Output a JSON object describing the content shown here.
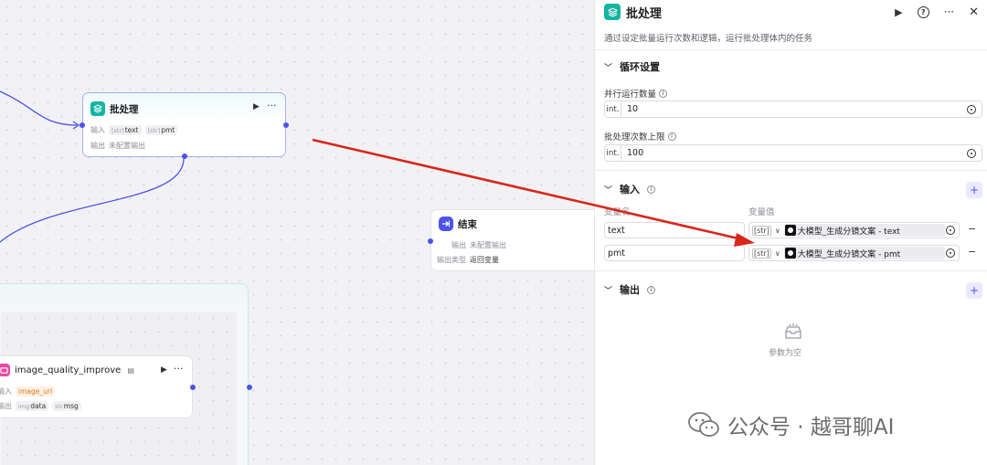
{
  "canvas": {
    "batch_node": {
      "title": "批处理",
      "input_label": "输入",
      "inputs": [
        {
          "type": "[str]",
          "name": "text"
        },
        {
          "type": "[str]",
          "name": "pmt"
        }
      ],
      "output_label": "输出",
      "output_value": "未配置输出"
    },
    "end_node": {
      "title": "结束",
      "output_label": "输出",
      "output_value": "未配置输出",
      "output_type_label": "输出类型",
      "output_type_value": "返回变量"
    },
    "plugin_node": {
      "title": "image_quality_improve",
      "input_label": "输入",
      "input_chip": "image_url",
      "output_label": "输出",
      "outputs": [
        {
          "type": "img",
          "name": "data"
        },
        {
          "type": "str",
          "name": "msg"
        }
      ]
    }
  },
  "panel": {
    "title": "批处理",
    "description": "通过设定批量运行次数和逻辑，运行批处理体内的任务",
    "loop_section": {
      "title": "循环设置",
      "parallel_label": "并行运行数量",
      "parallel_type": "int.",
      "parallel_value": "10",
      "max_label": "批处理次数上限",
      "max_type": "int.",
      "max_value": "100"
    },
    "input_section": {
      "title": "输入",
      "col_name": "变量名",
      "col_value": "变量值",
      "rows": [
        {
          "name": "text",
          "type": "[str]",
          "ref": "大模型_生成分镜文案 - text"
        },
        {
          "name": "pmt",
          "type": "[str]",
          "ref": "大模型_生成分镜文案 - pmt"
        }
      ]
    },
    "output_section": {
      "title": "输出",
      "empty_text": "参数为空"
    }
  },
  "watermark": {
    "text": "公众号 · 越哥聊AI"
  },
  "colors": {
    "accent": "#4d53e8",
    "batch_icon": "#13b5a1",
    "plugin_icon": "#e74aa6",
    "arrow": "#d9261c"
  }
}
